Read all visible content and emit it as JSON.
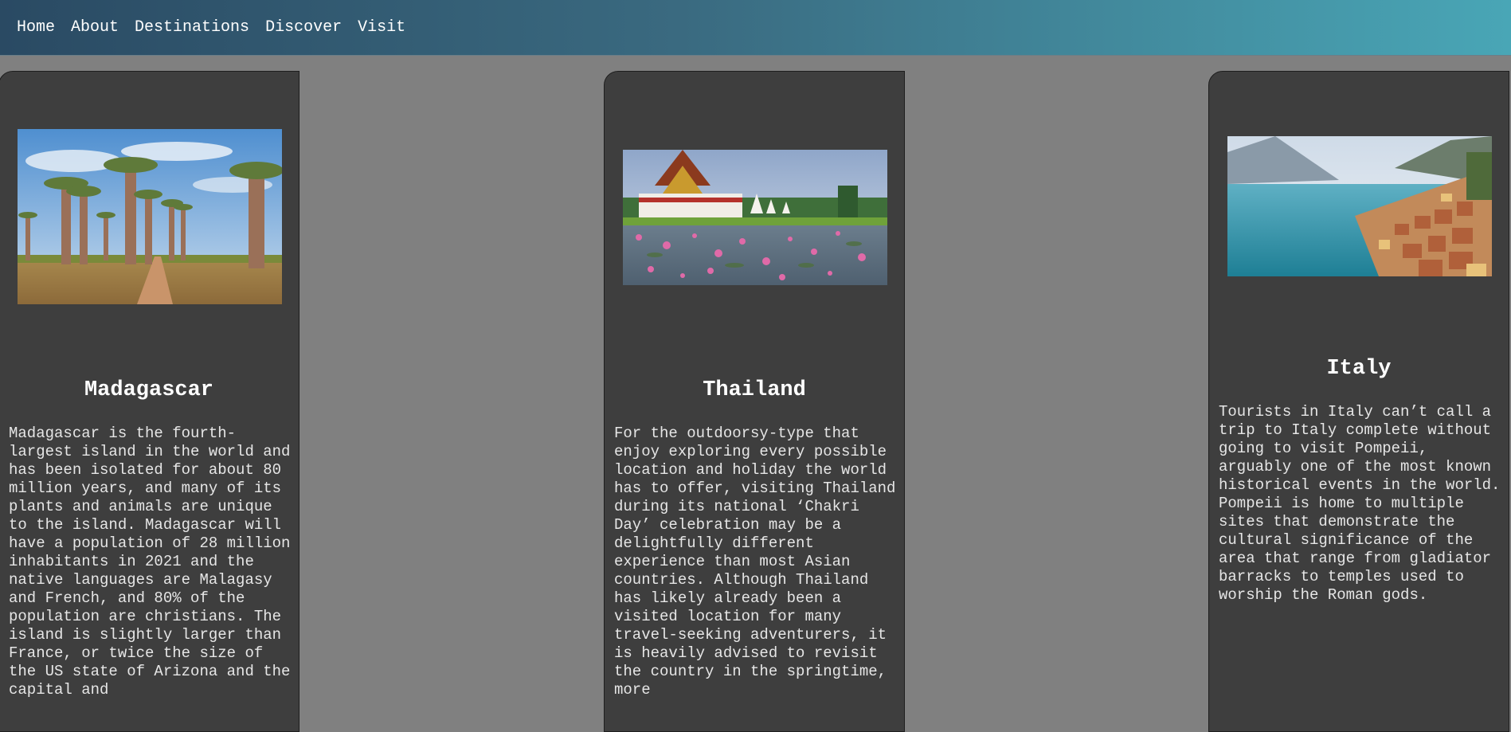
{
  "nav": {
    "links": [
      "Home",
      "About",
      "Destinations",
      "Discover",
      "Visit"
    ]
  },
  "colors": {
    "page_background": "#808080",
    "card_background": "#3e3e3e",
    "nav_gradient_start": "#2a4a63",
    "nav_gradient_end": "#49a6b6",
    "text": "#ffffff"
  },
  "destinations": [
    {
      "title": "Madagascar",
      "photo": "baobab-avenue-photo",
      "description": "Madagascar is the fourth-largest island in the world and has been isolated for about 80 million years, and many of its plants and animals are unique to the island. Madagascar will have a population of 28 million inhabitants in 2021 and the native languages are Malagasy and French, and 80% of the population are christians. The island is slightly larger than France, or twice the size of the US state of Arizona and the capital and"
    },
    {
      "title": "Thailand",
      "photo": "thai-temple-lotus-pond-photo",
      "description": "For the outdoorsy-type that enjoy exploring every possible location and holiday the world has to offer, visiting Thailand during its national ‘Chakri Day’ celebration may be a delightfully different experience than most Asian countries. Although Thailand has likely already been a visited location for many travel-seeking adventurers, it is heavily advised to revisit the country in the springtime, more"
    },
    {
      "title": "Italy",
      "photo": "italian-lakeside-town-photo",
      "description": "Tourists in Italy can’t call a trip to Italy complete without going to visit Pompeii, arguably one of the most known historical events in the world. Pompeii is home to multiple sites that demonstrate the cultural significance of the area that range from gladiator barracks to temples used to worship the Roman gods."
    }
  ]
}
